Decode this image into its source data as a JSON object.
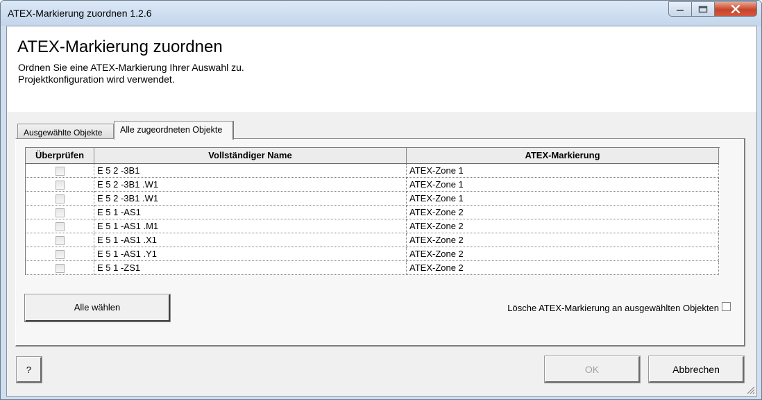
{
  "window": {
    "title": "ATEX-Markierung zuordnen 1.2.6",
    "controls": [
      "minimize-icon",
      "maximize-icon",
      "close-icon"
    ]
  },
  "header": {
    "title": "ATEX-Markierung zuordnen",
    "desc_line1": "Ordnen Sie eine ATEX-Markierung Ihrer Auswahl zu.",
    "desc_line2": "Projektkonfiguration wird verwendet."
  },
  "tabs": [
    {
      "label": "Ausgewählte Objekte",
      "active": false
    },
    {
      "label": "Alle zugeordneten Objekte",
      "active": true
    }
  ],
  "grid": {
    "columns": [
      "Überprüfen",
      "Vollständiger Name",
      "ATEX-Markierung"
    ],
    "rows": [
      {
        "checked": false,
        "name": "E 5 2 -3B1",
        "marking": "ATEX-Zone 1"
      },
      {
        "checked": false,
        "name": "E 5 2 -3B1 .W1",
        "marking": "ATEX-Zone 1"
      },
      {
        "checked": false,
        "name": "E 5 2 -3B1 .W1",
        "marking": "ATEX-Zone 1"
      },
      {
        "checked": false,
        "name": "E 5 1 -AS1",
        "marking": "ATEX-Zone 2"
      },
      {
        "checked": false,
        "name": "E 5 1 -AS1 .M1",
        "marking": "ATEX-Zone 2"
      },
      {
        "checked": false,
        "name": "E 5 1 -AS1 .X1",
        "marking": "ATEX-Zone 2"
      },
      {
        "checked": false,
        "name": "E 5 1 -AS1 .Y1",
        "marking": "ATEX-Zone 2"
      },
      {
        "checked": false,
        "name": "E 5 1 -ZS1",
        "marking": "ATEX-Zone 2"
      }
    ]
  },
  "actions": {
    "select_all": "Alle wählen",
    "delete_label": "Lösche ATEX-Markierung an ausgewählten Objekten",
    "delete_checked": false
  },
  "footer": {
    "help": "?",
    "ok": "OK",
    "ok_enabled": false,
    "cancel": "Abbrechen"
  },
  "colors": {
    "titlebar": "#c4d6ec",
    "close_button": "#c7442b",
    "dialog_bg": "#f0f0f0",
    "disabled_text": "#a0a0a0"
  }
}
